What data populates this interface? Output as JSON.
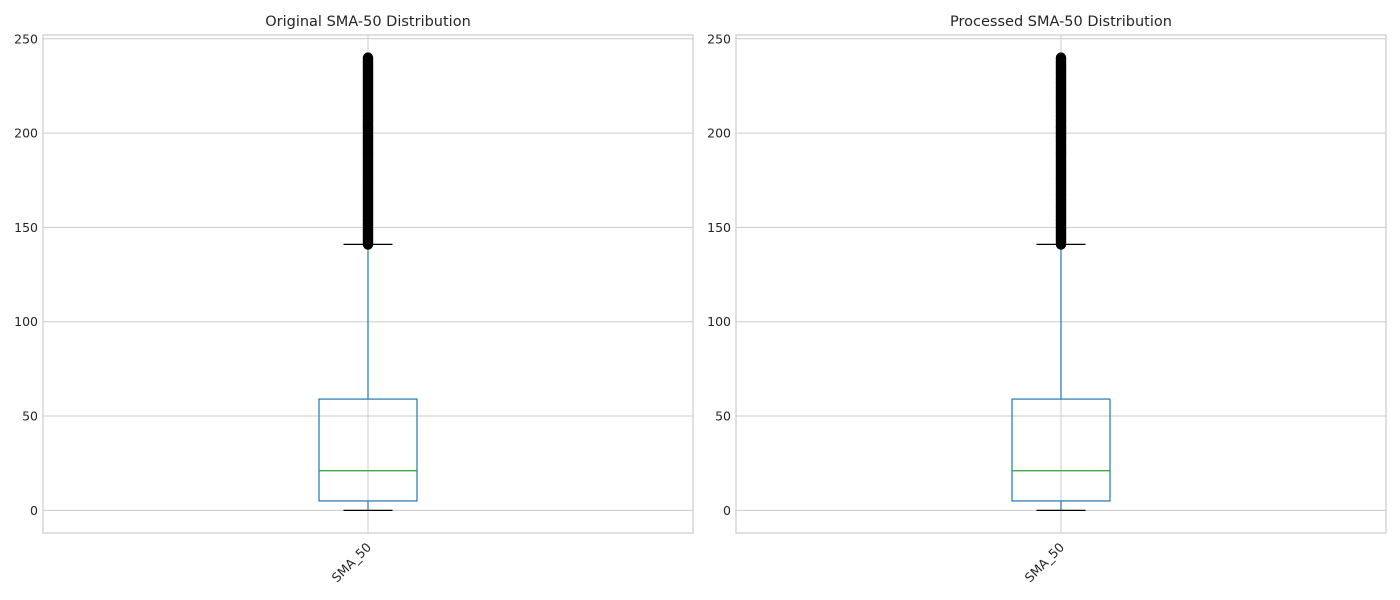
{
  "chart_data": [
    {
      "type": "box",
      "title": "Original SMA-50 Distribution",
      "categories": [
        "SMA_50"
      ],
      "ylim": [
        -12,
        252
      ],
      "yticks": [
        0,
        50,
        100,
        150,
        200,
        250
      ],
      "grid": true,
      "box": {
        "whisker_low": 0,
        "q1": 5,
        "median": 21,
        "q3": 59,
        "whisker_high": 141,
        "outlier_range": [
          141,
          240
        ]
      },
      "colors": {
        "box": "#1f77b4",
        "median": "#2ca02c",
        "whisker_cap": "#000000",
        "outlier": "#000000",
        "grid": "#cccccc"
      }
    },
    {
      "type": "box",
      "title": "Processed SMA-50 Distribution",
      "categories": [
        "SMA_50"
      ],
      "ylim": [
        -12,
        252
      ],
      "yticks": [
        0,
        50,
        100,
        150,
        200,
        250
      ],
      "grid": true,
      "box": {
        "whisker_low": 0,
        "q1": 5,
        "median": 21,
        "q3": 59,
        "whisker_high": 141,
        "outlier_range": [
          141,
          240
        ]
      },
      "colors": {
        "box": "#1f77b4",
        "median": "#2ca02c",
        "whisker_cap": "#000000",
        "outlier": "#000000",
        "grid": "#cccccc"
      }
    }
  ]
}
